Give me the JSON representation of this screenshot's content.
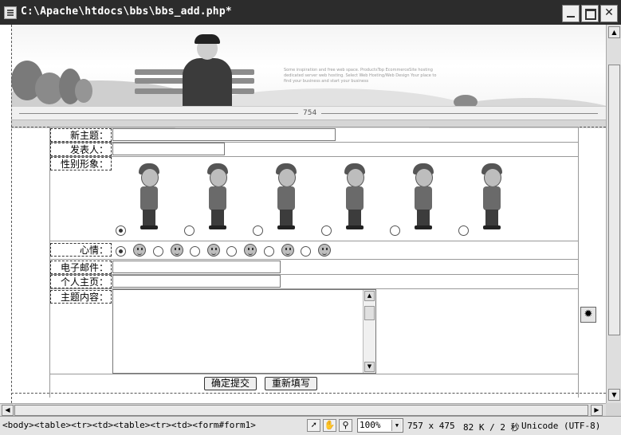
{
  "window": {
    "title": "C:\\Apache\\htdocs\\bbs\\bbs_add.php*"
  },
  "ruler": {
    "width_label": "754"
  },
  "banner": {
    "small_text": "Some inspiration and free web space. ProductsTop EcommerceSite hosting dedicated server web hosting. Select Web Hosting/Web Design Your place to find your business and start your business"
  },
  "form": {
    "labels": {
      "subject": "新主题：",
      "author": "发表人：",
      "avatar": "性别形象：",
      "mood": "心情：",
      "email": "电子邮件：",
      "homepage": "个人主页：",
      "content": "主题内容："
    },
    "avatar_options": [
      {
        "icon": "avatar-girl-hat-icon",
        "checked": true
      },
      {
        "icon": "avatar-boy-skateboard-icon",
        "checked": false
      },
      {
        "icon": "avatar-boy-headphones-icon",
        "checked": false
      },
      {
        "icon": "avatar-boy-cat-icon",
        "checked": false
      },
      {
        "icon": "avatar-boy-punk-icon",
        "checked": false
      },
      {
        "icon": "avatar-girl-longhair-icon",
        "checked": false
      }
    ],
    "mood_options": [
      {
        "icon": "angry-face-icon",
        "checked": true
      },
      {
        "icon": "cool-face-icon",
        "checked": false
      },
      {
        "icon": "surprised-face-icon",
        "checked": false
      },
      {
        "icon": "sad-face-icon",
        "checked": false
      },
      {
        "icon": "smiling-face-icon",
        "checked": false
      },
      {
        "icon": "grumpy-face-icon",
        "checked": false
      }
    ],
    "buttons": {
      "submit": "确定提交",
      "reset": "重新填写"
    }
  },
  "statusbar": {
    "tag_path": "<body><table><tr><td><table><tr><td><form#form1>",
    "zoom": "100%",
    "dimensions": "757 x 475",
    "filesize": "82 K / 2 秒",
    "encoding": "Unicode (UTF-8)"
  }
}
